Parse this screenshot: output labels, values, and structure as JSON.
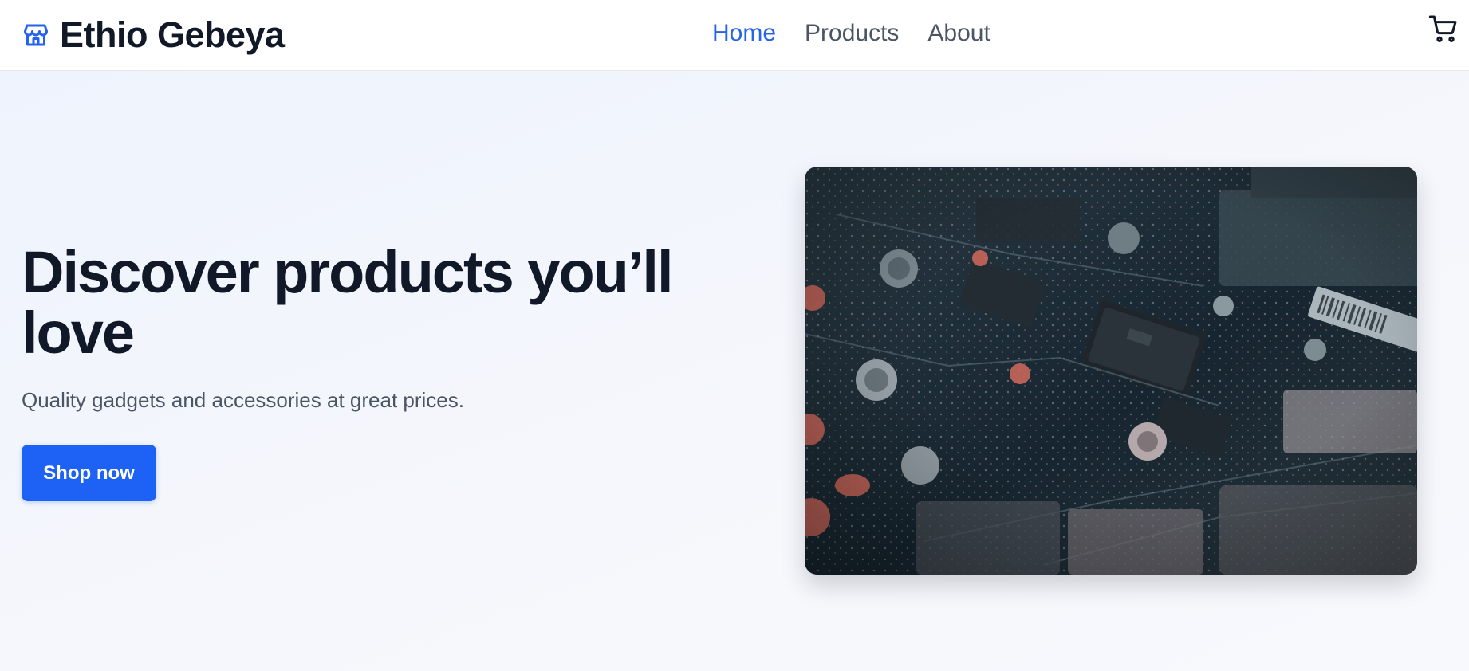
{
  "header": {
    "brand_name": "Ethio Gebeya",
    "brand_icon": "storefront-icon",
    "nav": [
      {
        "label": "Home",
        "active": true
      },
      {
        "label": "Products",
        "active": false
      },
      {
        "label": "About",
        "active": false
      }
    ],
    "cart_icon": "shopping-cart-icon"
  },
  "hero": {
    "title": "Discover products you’ll love",
    "subtitle": "Quality gadgets and accessories at great prices.",
    "cta_label": "Shop now",
    "image_subject": "circuit board close-up"
  },
  "colors": {
    "accent": "#2563eb",
    "button": "#1d62f5",
    "heading": "#111827",
    "muted_text": "#4b5563",
    "hero_background": "#f4f7fd"
  }
}
